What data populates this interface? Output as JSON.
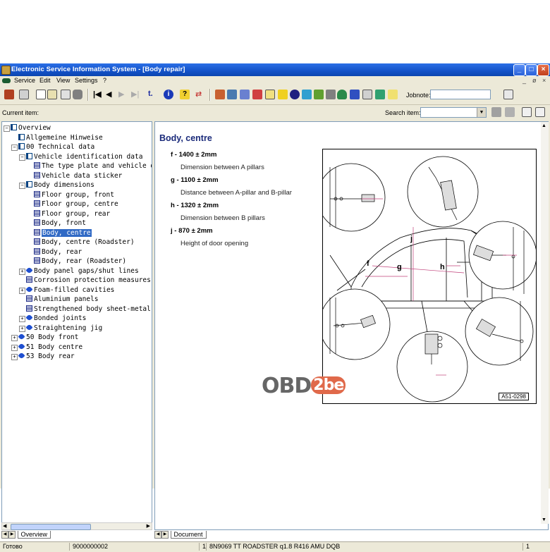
{
  "window": {
    "title": "Electronic Service Information System - [Body repair]",
    "min_glyph": "_",
    "max_glyph": "□",
    "close_glyph": "×",
    "mdi_controls": [
      "_",
      "ø",
      "×"
    ]
  },
  "menu": [
    "Service",
    "Edit",
    "View",
    "Settings",
    "?"
  ],
  "toolbar": {
    "jobnote_label": "Jobnote:",
    "jobnote_value": ""
  },
  "current_item_label": "Current item:",
  "search": {
    "label": "Search item:",
    "value": "",
    "drop_glyph": "▼"
  },
  "tree": {
    "items": [
      {
        "label": "Overview",
        "exp": "−",
        "icon": "book"
      },
      {
        "label": "Allgemeine Hinweise",
        "exp": "",
        "icon": "book"
      },
      {
        "label": "00 Technical data",
        "exp": "−",
        "icon": "book"
      },
      {
        "label": "Vehicle identification data",
        "exp": "−",
        "icon": "book"
      },
      {
        "label": "The type plate and vehicle data",
        "exp": "",
        "icon": "doc"
      },
      {
        "label": "Vehicle data sticker",
        "exp": "",
        "icon": "doc"
      },
      {
        "label": "Body dimensions",
        "exp": "−",
        "icon": "book"
      },
      {
        "label": "Floor group, front",
        "exp": "",
        "icon": "doc"
      },
      {
        "label": "Floor group, centre",
        "exp": "",
        "icon": "doc"
      },
      {
        "label": "Floor group, rear",
        "exp": "",
        "icon": "doc"
      },
      {
        "label": "Body, front",
        "exp": "",
        "icon": "doc"
      },
      {
        "label": "Body, centre",
        "exp": "",
        "icon": "doc",
        "selected": true
      },
      {
        "label": "Body, centre (Roadster)",
        "exp": "",
        "icon": "doc"
      },
      {
        "label": "Body, rear",
        "exp": "",
        "icon": "doc"
      },
      {
        "label": "Body, rear (Roadster)",
        "exp": "",
        "icon": "doc"
      },
      {
        "label": "Body panel gaps/shut lines",
        "exp": "+",
        "icon": "blue"
      },
      {
        "label": "Corrosion protection measures",
        "exp": "",
        "icon": "doc"
      },
      {
        "label": "Foam-filled cavities",
        "exp": "+",
        "icon": "blue"
      },
      {
        "label": "Aluminium panels",
        "exp": "",
        "icon": "doc"
      },
      {
        "label": "Strengthened body sheet-metal",
        "exp": "",
        "icon": "doc"
      },
      {
        "label": "Bonded joints",
        "exp": "+",
        "icon": "blue"
      },
      {
        "label": "Straightening jig",
        "exp": "+",
        "icon": "blue"
      },
      {
        "label": "50 Body front",
        "exp": "+",
        "icon": "blue"
      },
      {
        "label": "51 Body centre",
        "exp": "+",
        "icon": "blue"
      },
      {
        "label": "53 Body rear",
        "exp": "+",
        "icon": "blue"
      }
    ],
    "tab_label": "Overview"
  },
  "content": {
    "title": "Body, centre",
    "dimensions": [
      {
        "label": "f - 1400 ± 2mm",
        "desc": "Dimension between A pillars"
      },
      {
        "label": "g - 1100 ± 2mm",
        "desc": "Distance between A-pillar and B-pillar"
      },
      {
        "label": "h - 1320 ± 2mm",
        "desc": "Dimension between B pillars"
      },
      {
        "label": "j - 870 ± 2mm",
        "desc": "Height of door opening"
      }
    ],
    "figure_letters": [
      "j",
      "f",
      "g",
      "h"
    ],
    "figure_code": "A51-0298",
    "tab_label": "Document"
  },
  "watermark": {
    "part1": "OBD",
    "part2": "2be"
  },
  "status": {
    "ready": "Готово",
    "number": "9000000002",
    "page": "1",
    "vehicle": "8N9069  TT ROADSTER q1.8 R416  AMU  DQB",
    "count": "1"
  }
}
